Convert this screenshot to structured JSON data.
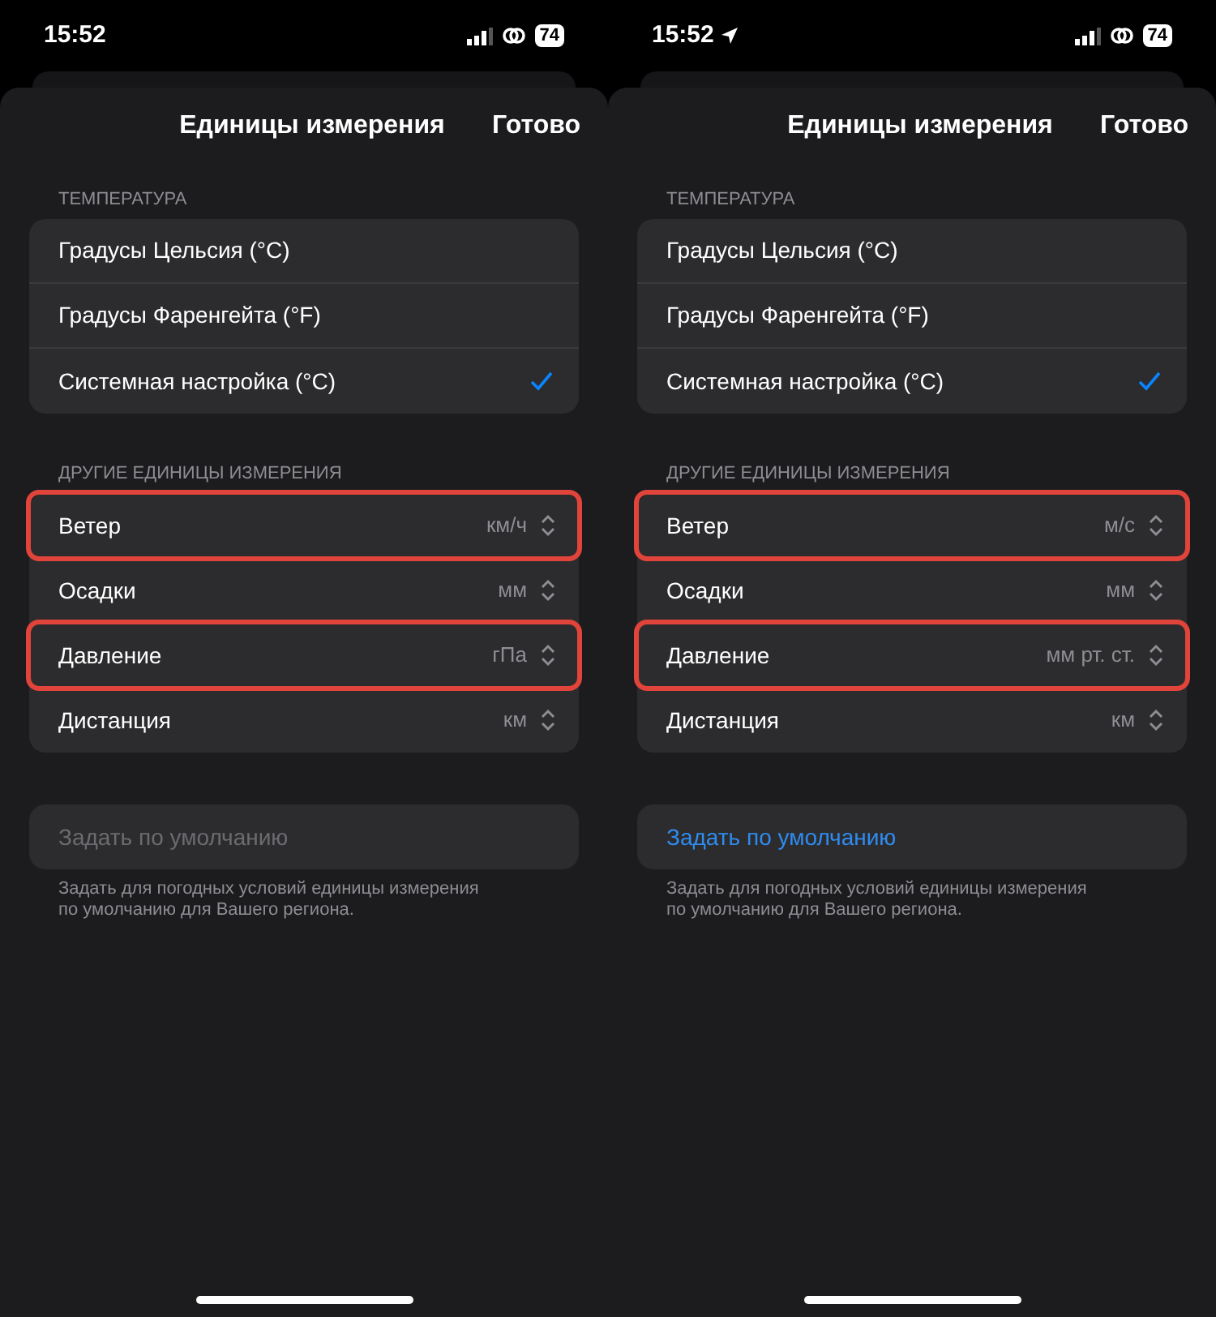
{
  "screens": [
    {
      "status_bar": {
        "time": "15:52",
        "location_services": false,
        "battery": "74"
      },
      "title": "Единицы измерения",
      "done": "Готово",
      "temperature": {
        "header": "ТЕМПЕРАТУРА",
        "options": [
          {
            "label": "Градусы Цельсия (°C)",
            "selected": false
          },
          {
            "label": "Градусы Фаренгейта (°F)",
            "selected": false
          },
          {
            "label": "Системная настройка (°C)",
            "selected": true
          }
        ]
      },
      "other": {
        "header": "ДРУГИЕ ЕДИНИЦЫ ИЗМЕРЕНИЯ",
        "rows": [
          {
            "label": "Ветер",
            "value": "км/ч",
            "highlighted": true
          },
          {
            "label": "Осадки",
            "value": "мм",
            "highlighted": false
          },
          {
            "label": "Давление",
            "value": "гПа",
            "highlighted": true
          },
          {
            "label": "Дистанция",
            "value": "км",
            "highlighted": false
          }
        ]
      },
      "default_button": {
        "label": "Задать по умолчанию",
        "disabled": true
      },
      "footnote": "Задать для погодных условий единицы измерения по умолчанию для Вашего региона."
    },
    {
      "status_bar": {
        "time": "15:52",
        "location_services": true,
        "battery": "74"
      },
      "title": "Единицы измерения",
      "done": "Готово",
      "temperature": {
        "header": "ТЕМПЕРАТУРА",
        "options": [
          {
            "label": "Градусы Цельсия (°C)",
            "selected": false
          },
          {
            "label": "Градусы Фаренгейта (°F)",
            "selected": false
          },
          {
            "label": "Системная настройка (°C)",
            "selected": true
          }
        ]
      },
      "other": {
        "header": "ДРУГИЕ ЕДИНИЦЫ ИЗМЕРЕНИЯ",
        "rows": [
          {
            "label": "Ветер",
            "value": "м/с",
            "highlighted": true
          },
          {
            "label": "Осадки",
            "value": "мм",
            "highlighted": false
          },
          {
            "label": "Давление",
            "value": "мм рт. ст.",
            "highlighted": true
          },
          {
            "label": "Дистанция",
            "value": "км",
            "highlighted": false
          }
        ]
      },
      "default_button": {
        "label": "Задать по умолчанию",
        "disabled": false
      },
      "footnote": "Задать для погодных условий единицы измерения по умолчанию для Вашего региона."
    }
  ]
}
